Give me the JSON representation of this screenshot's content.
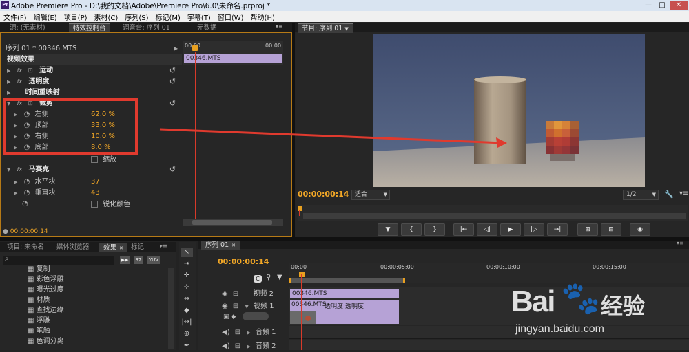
{
  "window": {
    "title": "Adobe Premiere Pro - D:\\我的文档\\Adobe\\Premiere Pro\\6.0\\未命名.prproj *",
    "app_icon": "Pr"
  },
  "menu": [
    "文件(F)",
    "编辑(E)",
    "项目(P)",
    "素材(C)",
    "序列(S)",
    "标记(M)",
    "字幕(T)",
    "窗口(W)",
    "帮助(H)"
  ],
  "left_tabs": [
    "源: (无素材)",
    "特效控制台",
    "调音台: 序列 01",
    "元数据"
  ],
  "effect_controls": {
    "sequence_label": "序列 01 * 00346.MTS",
    "ruler_start": "00:00",
    "ruler_end": "00:00",
    "clip_name": "00346.MTS",
    "section": "视频效果",
    "effects": {
      "motion": "运动",
      "opacity": "透明度",
      "time_remap": "时间重映射",
      "crop": "裁剪",
      "mosaic": "马赛克"
    },
    "crop_params": [
      {
        "name": "左侧",
        "value": "62.0",
        "unit": "%"
      },
      {
        "name": "顶部",
        "value": "33.0",
        "unit": "%"
      },
      {
        "name": "右侧",
        "value": "10.0",
        "unit": "%"
      },
      {
        "name": "底部",
        "value": "8.0",
        "unit": "%"
      }
    ],
    "zoom_label": "缩放",
    "mosaic_params": [
      {
        "name": "水平块",
        "value": "37"
      },
      {
        "name": "垂直块",
        "value": "43"
      }
    ],
    "sharpen_label": "锐化颜色",
    "timecode": "00:00:00:14"
  },
  "program": {
    "tab": "节目: 序列 01",
    "timecode": "00:00:00:14",
    "fit": "适合",
    "fraction": "1/2",
    "controls": [
      "▼",
      "{",
      "}",
      "|←",
      "◁|",
      "▶",
      "|▷",
      "→|",
      "⊞",
      "⊟",
      "◉"
    ]
  },
  "project": {
    "tabs": [
      "项目: 未命名",
      "媒体浏览器",
      "效果",
      "标记"
    ],
    "filter_labels": [
      "32",
      "YUV"
    ],
    "items": [
      "复制",
      "彩色浮雕",
      "曝光过度",
      "材质",
      "查找边缘",
      "浮雕",
      "笔触",
      "色调分离"
    ]
  },
  "timeline": {
    "tab": "序列 01",
    "timecode": "00:00:00:14",
    "ticks": [
      "00:00",
      "00:00:05:00",
      "00:00:10:00",
      "00:00:15:00"
    ],
    "tracks": {
      "video2": "视频 2",
      "video1": "视频 1",
      "audio1": "音频 1",
      "audio2": "音频 2"
    },
    "clip_v2": "00346.MTS",
    "clip_v1": "00346.MTS",
    "clip_v1_fx": "透明度:透明度",
    "zero": "0"
  },
  "watermark": {
    "text1": "Bai",
    "text2": "经验",
    "url": "jingyan.baidu.com"
  },
  "colors": {
    "accent_orange": "#f0a626",
    "annotation_red": "#e03a2e",
    "clip_purple": "#b6a2d6"
  }
}
